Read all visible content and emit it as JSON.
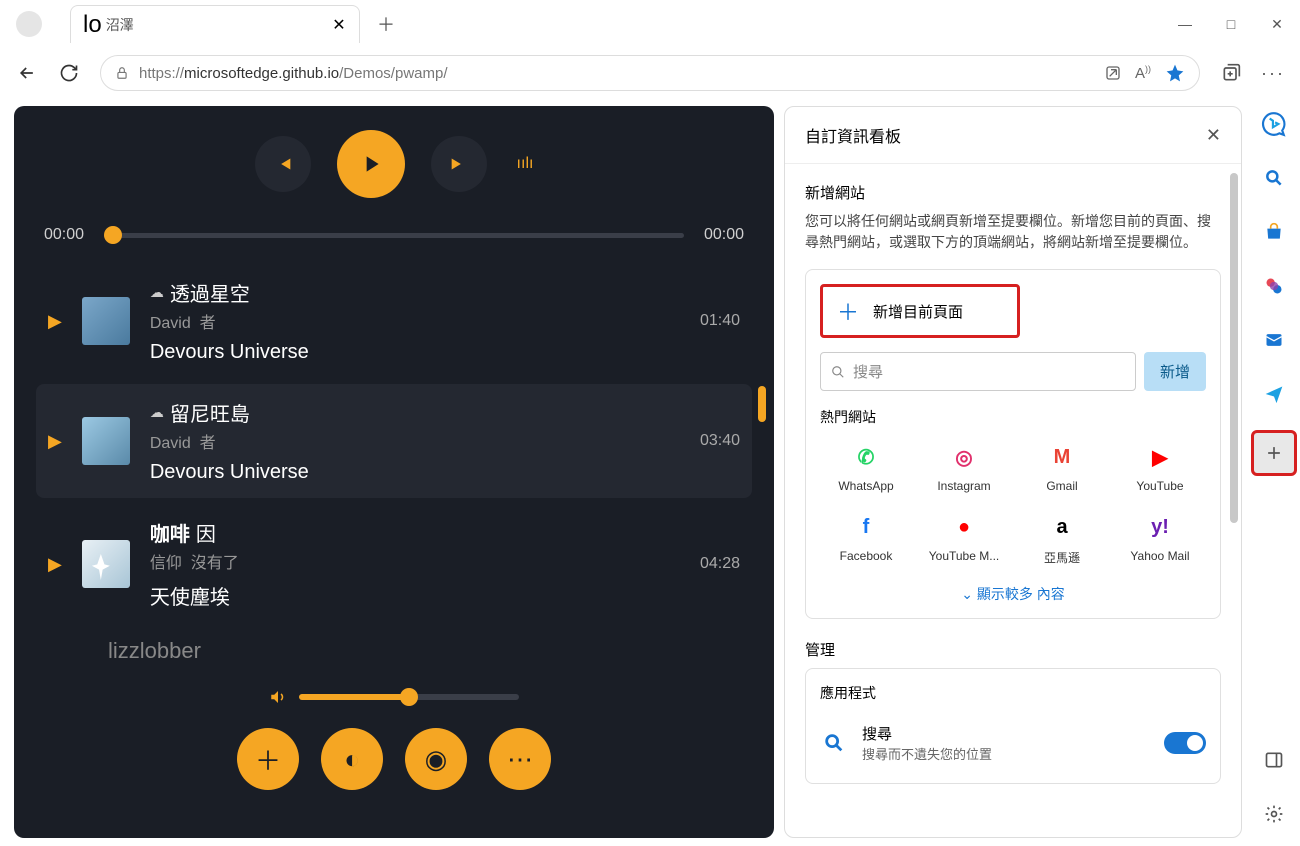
{
  "tab": {
    "title": "lo",
    "subtitle": "沼澤"
  },
  "url_host": "https://",
  "url_domain": "microsoftedge.github.io",
  "url_path": "/Demos/pwamp/",
  "player": {
    "time_current": "00:00",
    "time_total": "00:00",
    "songs": [
      {
        "title_pre": "透過星空",
        "artist": "David",
        "role": "者",
        "album": "Devours Universe",
        "duration": "01:40",
        "cloud": true
      },
      {
        "title_pre": "留尼旺島",
        "artist": "David",
        "role": "者",
        "album": "Devours Universe",
        "duration": "03:40",
        "cloud": true
      },
      {
        "title_bold": "咖啡",
        "title_rest": "因",
        "artist": "信仰",
        "role": "沒有了",
        "album": "天使塵埃",
        "duration": "04:28",
        "cloud": false
      }
    ],
    "cut_song": "lizzlobber"
  },
  "sidepanel": {
    "title": "自訂資訊看板",
    "add_section_title": "新增網站",
    "add_desc": "您可以將任何網站或網頁新增至提要欄位。新增您目前的頁面、搜尋熱門網站，或選取下方的頂端網站，將網站新增至提要欄位。",
    "add_current": "新增目前頁面",
    "search_placeholder": "搜尋",
    "search_btn": "新增",
    "hot_title": "熱門網站",
    "sites": [
      {
        "label": "WhatsApp",
        "color": "#25d366",
        "glyph": "✆"
      },
      {
        "label": "Instagram",
        "color": "#e1306c",
        "glyph": "◎"
      },
      {
        "label": "Gmail",
        "color": "#ea4335",
        "glyph": "M"
      },
      {
        "label": "YouTube",
        "color": "#ff0000",
        "glyph": "▶"
      },
      {
        "label": "Facebook",
        "color": "#1877f2",
        "glyph": "f"
      },
      {
        "label": "YouTube M...",
        "color": "#ff0000",
        "glyph": "●"
      },
      {
        "label": "亞馬遜",
        "color": "#000",
        "glyph": "a"
      },
      {
        "label": "Yahoo Mail",
        "color": "#6b1fb1",
        "glyph": "y!"
      }
    ],
    "show_more": "顯示較多 內容",
    "manage_title": "管理",
    "apps_title": "應用程式",
    "app_search_name": "搜尋",
    "app_search_desc": "搜尋而不遺失您的位置"
  }
}
